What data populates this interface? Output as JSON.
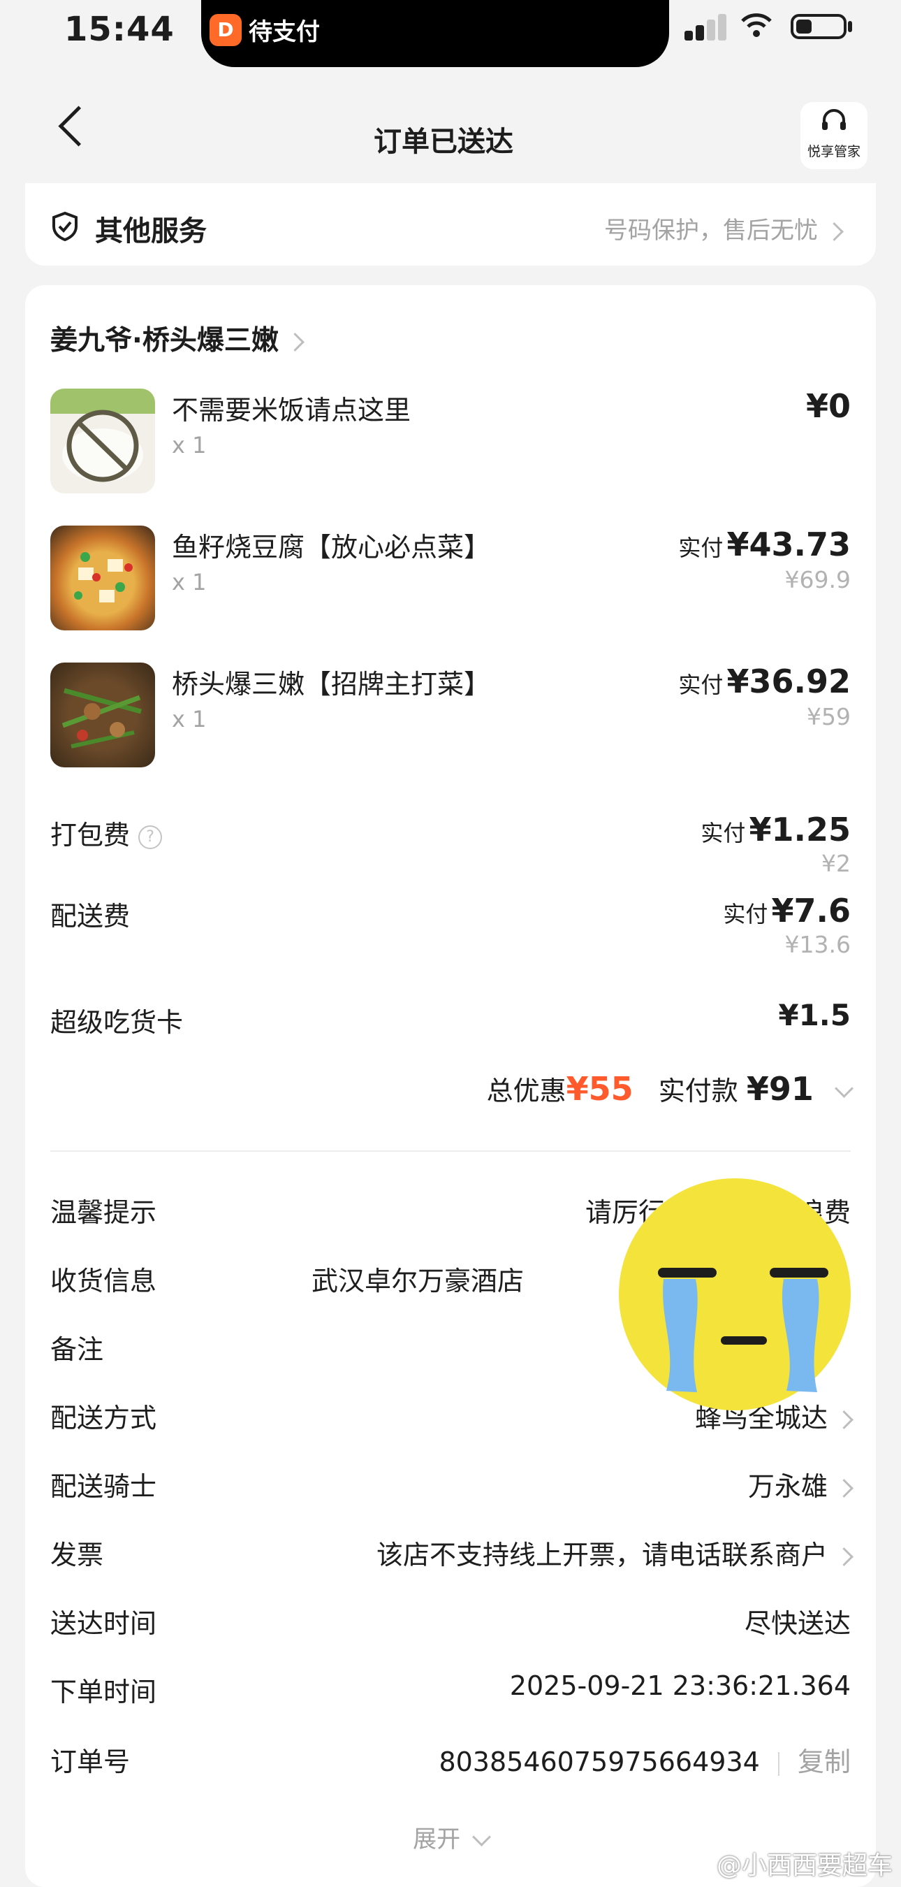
{
  "status_bar": {
    "time": "15:44",
    "island_app_glyph": "D",
    "island_text": "待支付",
    "wifi_glyph": "◠"
  },
  "nav": {
    "back_glyph": "",
    "title": "订单已送达",
    "butler_icon": "🎧",
    "butler_label": "悦享管家"
  },
  "service": {
    "icon": "shield-check-icon",
    "label": "其他服务",
    "desc": "号码保护，售后无忧"
  },
  "shop": {
    "name": "姜九爷·桥头爆三嫩"
  },
  "items": [
    {
      "name": "不需要米饭请点这里",
      "qty": "x 1",
      "paid_label": "",
      "price": "¥0",
      "original": ""
    },
    {
      "name": "鱼籽烧豆腐【放心必点菜】",
      "qty": "x 1",
      "paid_label": "实付",
      "price": "¥43.73",
      "original": "¥69.9"
    },
    {
      "name": "桥头爆三嫩【招牌主打菜】",
      "qty": "x 1",
      "paid_label": "实付",
      "price": "¥36.92",
      "original": "¥59"
    }
  ],
  "fees": {
    "packing": {
      "label": "打包费",
      "help_glyph": "?",
      "paid_label": "实付",
      "price": "¥1.25",
      "original": "¥2"
    },
    "delivery": {
      "label": "配送费",
      "paid_label": "实付",
      "price": "¥7.6",
      "original": "¥13.6"
    },
    "card": {
      "label": "超级吃货卡",
      "price": "¥1.5"
    }
  },
  "summary": {
    "discount_label": "总优惠",
    "discount": "¥55",
    "total_label": "实付款",
    "total": "¥91"
  },
  "info": [
    {
      "label": "温馨提示",
      "value": "请厉行节约，拒绝浪费"
    },
    {
      "label": "收货信息",
      "value": "武汉卓尔万豪酒店"
    },
    {
      "label": "备注",
      "value": ""
    },
    {
      "label": "配送方式",
      "value": "蜂鸟全城达"
    },
    {
      "label": "配送骑士",
      "value": "万永雄"
    },
    {
      "label": "发票",
      "value": "该店不支持线上开票，请电话联系商户"
    },
    {
      "label": "送达时间",
      "value": "尽快送达"
    },
    {
      "label": "下单时间",
      "value": "2025-09-21 23:36:21.364"
    },
    {
      "label": "订单号",
      "value": "8038546075975664934",
      "action": "复制"
    }
  ],
  "expand": "展开",
  "watermark": "@小西西要超车",
  "colors": {
    "discount": "#ff5a2c",
    "accent": "#ff6a28",
    "sticker": "#f4e33a",
    "tears": "#7ab8f0"
  }
}
